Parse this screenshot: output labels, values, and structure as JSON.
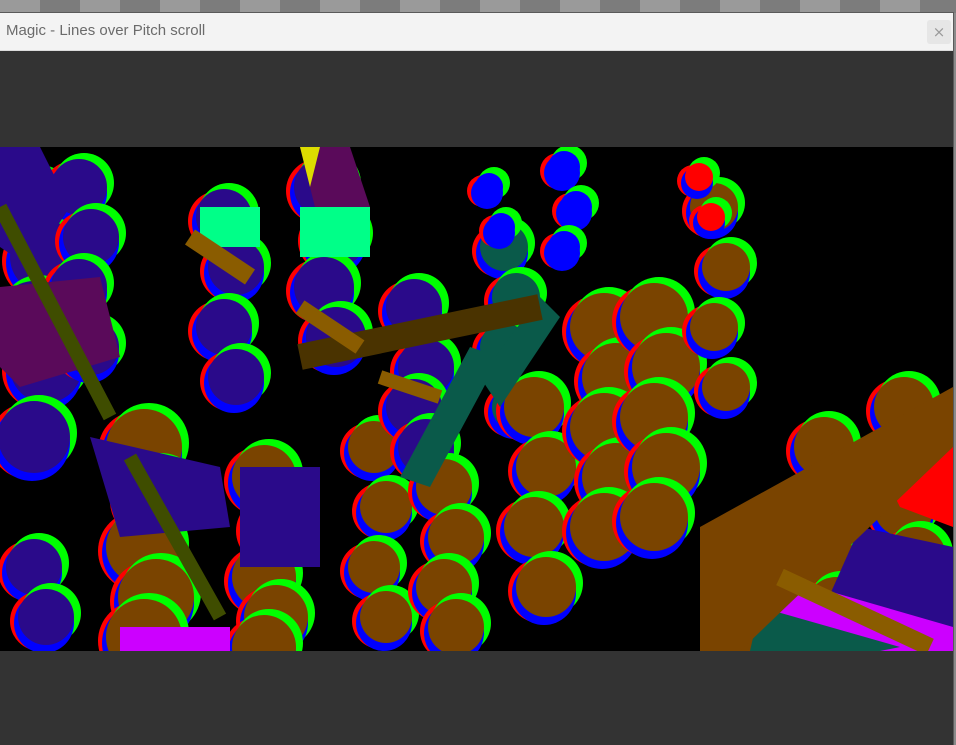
{
  "window": {
    "title": "Magic - Lines over Pitch scroll",
    "close_label": "×"
  },
  "canvas": {
    "background": "#000000",
    "palette": {
      "red": "#ff0000",
      "green": "#00ff00",
      "blue": "#0000ff",
      "purple": "#2a0a8a",
      "brown": "#7a4400",
      "dark_brown": "#4a3300",
      "olive": "#3f4d00",
      "teal": "#0a5a4a",
      "magenta": "#cc00ff",
      "mint": "#00ff88",
      "maroon": "#5a0a5a",
      "yellow": "#dddd00",
      "ocher": "#8a5c00"
    }
  }
}
